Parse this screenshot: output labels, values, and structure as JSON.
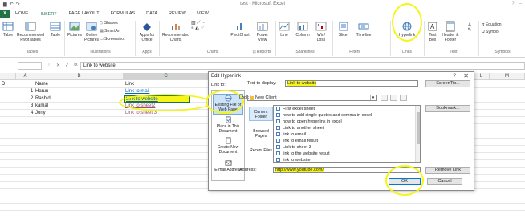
{
  "window": {
    "title": "test - Microsoft Excel",
    "help": "?"
  },
  "ribbon": {
    "file_tab": "FILE",
    "tabs": [
      "HOME",
      "INSERT",
      "PAGE LAYOUT",
      "FORMULAS",
      "DATA",
      "REVIEW",
      "VIEW"
    ],
    "active_tab": "INSERT",
    "buttons": {
      "table": "Table",
      "recommended_pivottables": "Recommended PivotTables",
      "table2": "Table",
      "pictures": "Pictures",
      "online_pictures": "Online Pictures",
      "shapes": "Shapes",
      "smartart": "SmartArt",
      "screenshot": "Screenshot",
      "apps_for_office": "Apps for Office",
      "recommended_charts": "Recommended Charts",
      "pivotchart": "PivotChart",
      "power_view": "Power View",
      "line": "Line",
      "column": "Column",
      "win_loss": "Win/ Loss",
      "slicer": "Slicer",
      "timeline": "Timeline",
      "hyperlink": "Hyperlink",
      "text_box": "Text Box",
      "header_footer": "Header & Footer",
      "equation": "Equation",
      "symbol": "Symbol"
    },
    "groups": {
      "tables": "Tables",
      "illustrations": "Illustrations",
      "apps": "Apps",
      "charts": "Charts",
      "reports": "Reports",
      "sparklines": "Sparklines",
      "filters": "Filters",
      "links": "Links",
      "text": "Text",
      "symbols": "Symbols"
    }
  },
  "formula_bar": {
    "fx": "fx",
    "content": "Link to website"
  },
  "grid": {
    "columns": [
      "A",
      "B",
      "C",
      "D",
      "L",
      "M"
    ],
    "row_d": "D",
    "header_name": "Name",
    "header_link": "Link",
    "rows": [
      {
        "num": "1",
        "name": "Harun",
        "link": "Link to mail"
      },
      {
        "num": "2",
        "name": "Rashid",
        "link": "Link to website"
      },
      {
        "num": "3",
        "name": "kamal",
        "link": "Link to sheet2"
      },
      {
        "num": "4",
        "name": "Jony",
        "link": "Link to sheet 3"
      }
    ]
  },
  "dialog": {
    "title": "Edit Hyperlink",
    "help": "?",
    "close": "✕",
    "link_to_label": "Link to:",
    "link_to": [
      "Existing File or Web Page",
      "Place in This Document",
      "Create New Document",
      "E-mail Address"
    ],
    "text_to_display_label": "Text to display:",
    "text_to_display_value": "Link to website",
    "screentip_button": "ScreenTip...",
    "look_in_label": "Look in:",
    "look_in_value": "New Client",
    "nav": [
      "Current Folder",
      "Browsed Pages",
      "Recent Files"
    ],
    "files": [
      "First excel sheet",
      "how to add single quotes and comma in excel",
      "how to open hyperlink in excel",
      "Link to another sheet",
      "link to email",
      "link to email result",
      "Link to sheet 3",
      "link to the website result",
      "link to website"
    ],
    "bookmark_button": "Bookmark...",
    "address_label": "Address:",
    "address_value": "http://www.youtube.com/",
    "remove_link_button": "Remove Link",
    "ok_button": "OK",
    "cancel_button": "Cancel"
  }
}
